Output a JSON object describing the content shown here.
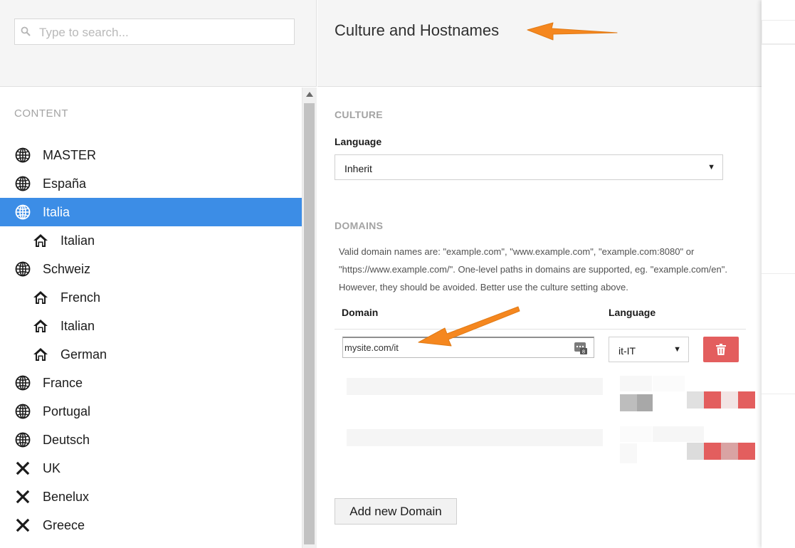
{
  "search": {
    "placeholder": "Type to search..."
  },
  "tree": {
    "section": "CONTENT",
    "items": [
      {
        "label": "MASTER",
        "icon": "globe-icon",
        "level": 0
      },
      {
        "label": "España",
        "icon": "globe-icon",
        "level": 0
      },
      {
        "label": "Italia",
        "icon": "globe-icon",
        "level": 0,
        "selected": true
      },
      {
        "label": "Italian",
        "icon": "home-icon",
        "level": 1
      },
      {
        "label": "Schweiz",
        "icon": "globe-icon",
        "level": 0
      },
      {
        "label": "French",
        "icon": "home-icon",
        "level": 1
      },
      {
        "label": "Italian",
        "icon": "home-icon",
        "level": 1
      },
      {
        "label": "German",
        "icon": "home-icon",
        "level": 1
      },
      {
        "label": "France",
        "icon": "globe-icon",
        "level": 0
      },
      {
        "label": "Portugal",
        "icon": "globe-icon",
        "level": 0
      },
      {
        "label": "Deutsch",
        "icon": "globe-icon",
        "level": 0
      },
      {
        "label": "UK",
        "icon": "close-icon",
        "level": 0
      },
      {
        "label": "Benelux",
        "icon": "close-icon",
        "level": 0
      },
      {
        "label": "Greece",
        "icon": "close-icon",
        "level": 0
      }
    ]
  },
  "panel": {
    "title": "Culture and Hostnames",
    "culture": {
      "section": "CULTURE",
      "language_label": "Language",
      "language_value": "Inherit"
    },
    "domains": {
      "section": "DOMAINS",
      "help": "Valid domain names are: \"example.com\", \"www.example.com\", \"example.com:8080\" or \"https://www.example.com/\". One-level paths in domains are supported, eg. \"example.com/en\". However, they should be avoided. Better use the culture setting above.",
      "col_domain": "Domain",
      "col_language": "Language",
      "row": {
        "domain": "mysite.com/it",
        "language": "it-IT"
      },
      "add_button": "Add new Domain"
    }
  },
  "colors": {
    "selected": "#3c8de6",
    "delete": "#e35e5e",
    "arrow": "#f5871f"
  }
}
